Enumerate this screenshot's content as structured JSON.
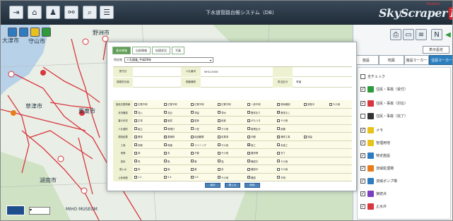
{
  "header": {
    "title": "下水道管路台帳システム（DB）",
    "buttons": [
      "exit-icon",
      "home-icon",
      "user-icon",
      "network-icon",
      "search-icon",
      "menu-icon"
    ],
    "logo": {
      "text": "SkyScraper",
      "badge": "PL",
      "small": "Pipeline"
    }
  },
  "map": {
    "labels": [
      {
        "text": "守山市"
      },
      {
        "text": "野洲市"
      },
      {
        "text": "大津市"
      },
      {
        "text": "栗東市"
      },
      {
        "text": "草津市"
      },
      {
        "text": "湖南市"
      },
      {
        "text": "MIHO MUSEUM"
      }
    ],
    "tool_colors": [
      "#2f7bbf",
      "#2f7bbf",
      "#e8c21b",
      "#2e9b3a"
    ],
    "pipe_color": "#d9363e",
    "water_color": "#b7d1e8",
    "green_color": "#cfe2c4"
  },
  "right_panel": {
    "display_settings": "表示設定",
    "tabs": [
      "施設",
      "地図",
      "施設マーカー",
      "住民マーカー"
    ],
    "active_tab": 3,
    "items": [
      {
        "label": "全チェック",
        "checked": false,
        "color": ""
      },
      {
        "label": "住民・事故（受付）",
        "checked": true,
        "color": "#2e9b3a"
      },
      {
        "label": "住民・事故（対応）",
        "checked": true,
        "color": "#d9363e"
      },
      {
        "label": "住民・事故（完了）",
        "checked": false,
        "color": "#333333"
      },
      {
        "label": "メモ",
        "checked": true,
        "color": "#e8c21b"
      },
      {
        "label": "管理用地",
        "checked": true,
        "color": "#e8c21b"
      },
      {
        "label": "特定施設",
        "checked": true,
        "color": "#2f7bbf"
      },
      {
        "label": "流域処理場",
        "checked": true,
        "color": "#e87c1b"
      },
      {
        "label": "流域ポンプ場",
        "checked": true,
        "color": "#2f7bbf"
      },
      {
        "label": "接続点",
        "checked": true,
        "color": "#7a3fbf"
      },
      {
        "label": "止水弁",
        "checked": true,
        "color": "#d9363e"
      }
    ]
  },
  "modal": {
    "tabs": [
      "基本情報",
      "出前情報",
      "処理状況",
      "写真"
    ],
    "active_tab": 0,
    "address_label": "所在地",
    "address_value": "人孔調査_平成28年",
    "fields": [
      {
        "label": "受付日",
        "value": "",
        "label2": "人孔番号",
        "value2": "MH123456",
        "label3": "",
        "value3": ""
      },
      {
        "label": "調査担当者",
        "value": "",
        "label2": "調査種別",
        "value2": "",
        "label3": "担当区分",
        "value3": "有害"
      }
    ],
    "check_rows": [
      {
        "label": "施設位置情報",
        "opts": [
          {
            "t": "位置不明",
            "c": false
          },
          {
            "t": "位置不明",
            "c": false
          },
          {
            "t": "位置不明",
            "c": false
          },
          {
            "t": "位置不明",
            "c": false
          },
          {
            "t": "一部不明",
            "c": false
          },
          {
            "t": "現地確認",
            "c": true
          },
          {
            "t": "調査中",
            "c": false
          },
          {
            "t": "その他",
            "c": false
          }
        ]
      },
      {
        "label": "状況確認",
        "opts": [
          {
            "t": "流入",
            "c": false
          },
          {
            "t": "流出",
            "c": false
          },
          {
            "t": "滞留",
            "c": false
          },
          {
            "t": "滞水",
            "c": false
          },
          {
            "t": "異常あり",
            "c": false
          },
          {
            "t": "異常なし",
            "c": true
          }
        ]
      },
      {
        "label": "蓋の状況",
        "opts": [
          {
            "t": "正常",
            "c": false
          },
          {
            "t": "破損",
            "c": true
          },
          {
            "t": "腐食",
            "c": false
          },
          {
            "t": "段差",
            "c": false
          },
          {
            "t": "がたつき",
            "c": false
          },
          {
            "t": "その他",
            "c": false
          }
        ]
      },
      {
        "label": "人孔種別",
        "opts": [
          {
            "t": "組立",
            "c": false
          },
          {
            "t": "現場打",
            "c": false
          },
          {
            "t": "小型",
            "c": false
          },
          {
            "t": "その他",
            "c": false
          },
          {
            "t": "管理区分",
            "c": false
          },
          {
            "t": "設備",
            "c": false
          }
        ]
      },
      {
        "label": "調査結果",
        "opts": [
          {
            "t": "異常",
            "c": false
          },
          {
            "t": "要補修",
            "c": true
          },
          {
            "t": "経過観察",
            "c": false
          },
          {
            "t": "処置済",
            "c": false
          },
          {
            "t": "外観",
            "c": false
          },
          {
            "t": "補修工事",
            "c": true
          },
          {
            "t": "保留",
            "c": false
          }
        ]
      },
      {
        "label": "工事",
        "opts": [
          {
            "t": "改築",
            "c": false
          },
          {
            "t": "修繕",
            "c": false
          },
          {
            "t": "ライニング",
            "c": false
          },
          {
            "t": "その他",
            "c": false
          },
          {
            "t": "施工",
            "c": true
          },
          {
            "t": "未施工",
            "c": false
          }
        ]
      },
      {
        "label": "清掃",
        "opts": [
          {
            "t": "済",
            "c": false
          },
          {
            "t": "未",
            "c": false
          },
          {
            "t": "不要",
            "c": false
          },
          {
            "t": "その他",
            "c": false
          },
          {
            "t": "要清掃",
            "c": false
          },
          {
            "t": "完了",
            "c": false
          }
        ]
      },
      {
        "label": "臭気",
        "opts": [
          {
            "t": "有",
            "c": false
          },
          {
            "t": "無",
            "c": false
          },
          {
            "t": "微",
            "c": false
          },
          {
            "t": "強",
            "c": false
          },
          {
            "t": "確認中",
            "c": false
          },
          {
            "t": "その他",
            "c": false
          }
        ]
      },
      {
        "label": "侵入水",
        "opts": [
          {
            "t": "有",
            "c": false
          },
          {
            "t": "無",
            "c": false
          },
          {
            "t": "微",
            "c": false
          },
          {
            "t": "多",
            "c": false
          },
          {
            "t": "確認中",
            "c": false
          },
          {
            "t": "その他",
            "c": false
          }
        ]
      },
      {
        "label": "土砂堆積",
        "opts": [
          {
            "t": "1-2",
            "c": false
          },
          {
            "t": "3-4",
            "c": false
          },
          {
            "t": "5-6",
            "c": false
          },
          {
            "t": "その他",
            "c": false
          },
          {
            "t": "確認",
            "c": false
          },
          {
            "t": "不明",
            "c": false
          }
        ]
      }
    ],
    "buttons": [
      "保存",
      "閉じる",
      "削除"
    ]
  }
}
